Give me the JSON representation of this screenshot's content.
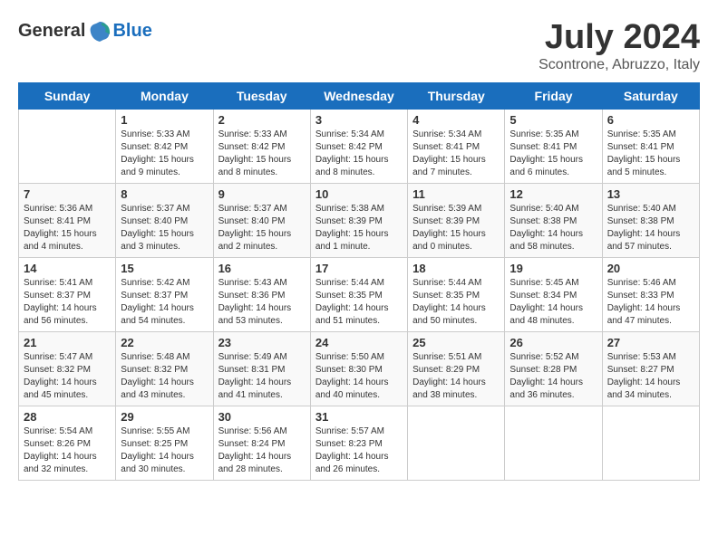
{
  "header": {
    "logo_general": "General",
    "logo_blue": "Blue",
    "month_title": "July 2024",
    "subtitle": "Scontrone, Abruzzo, Italy"
  },
  "days_of_week": [
    "Sunday",
    "Monday",
    "Tuesday",
    "Wednesday",
    "Thursday",
    "Friday",
    "Saturday"
  ],
  "weeks": [
    [
      {
        "day": "",
        "info": ""
      },
      {
        "day": "1",
        "info": "Sunrise: 5:33 AM\nSunset: 8:42 PM\nDaylight: 15 hours\nand 9 minutes."
      },
      {
        "day": "2",
        "info": "Sunrise: 5:33 AM\nSunset: 8:42 PM\nDaylight: 15 hours\nand 8 minutes."
      },
      {
        "day": "3",
        "info": "Sunrise: 5:34 AM\nSunset: 8:42 PM\nDaylight: 15 hours\nand 8 minutes."
      },
      {
        "day": "4",
        "info": "Sunrise: 5:34 AM\nSunset: 8:41 PM\nDaylight: 15 hours\nand 7 minutes."
      },
      {
        "day": "5",
        "info": "Sunrise: 5:35 AM\nSunset: 8:41 PM\nDaylight: 15 hours\nand 6 minutes."
      },
      {
        "day": "6",
        "info": "Sunrise: 5:35 AM\nSunset: 8:41 PM\nDaylight: 15 hours\nand 5 minutes."
      }
    ],
    [
      {
        "day": "7",
        "info": "Sunrise: 5:36 AM\nSunset: 8:41 PM\nDaylight: 15 hours\nand 4 minutes."
      },
      {
        "day": "8",
        "info": "Sunrise: 5:37 AM\nSunset: 8:40 PM\nDaylight: 15 hours\nand 3 minutes."
      },
      {
        "day": "9",
        "info": "Sunrise: 5:37 AM\nSunset: 8:40 PM\nDaylight: 15 hours\nand 2 minutes."
      },
      {
        "day": "10",
        "info": "Sunrise: 5:38 AM\nSunset: 8:39 PM\nDaylight: 15 hours\nand 1 minute."
      },
      {
        "day": "11",
        "info": "Sunrise: 5:39 AM\nSunset: 8:39 PM\nDaylight: 15 hours\nand 0 minutes."
      },
      {
        "day": "12",
        "info": "Sunrise: 5:40 AM\nSunset: 8:38 PM\nDaylight: 14 hours\nand 58 minutes."
      },
      {
        "day": "13",
        "info": "Sunrise: 5:40 AM\nSunset: 8:38 PM\nDaylight: 14 hours\nand 57 minutes."
      }
    ],
    [
      {
        "day": "14",
        "info": "Sunrise: 5:41 AM\nSunset: 8:37 PM\nDaylight: 14 hours\nand 56 minutes."
      },
      {
        "day": "15",
        "info": "Sunrise: 5:42 AM\nSunset: 8:37 PM\nDaylight: 14 hours\nand 54 minutes."
      },
      {
        "day": "16",
        "info": "Sunrise: 5:43 AM\nSunset: 8:36 PM\nDaylight: 14 hours\nand 53 minutes."
      },
      {
        "day": "17",
        "info": "Sunrise: 5:44 AM\nSunset: 8:35 PM\nDaylight: 14 hours\nand 51 minutes."
      },
      {
        "day": "18",
        "info": "Sunrise: 5:44 AM\nSunset: 8:35 PM\nDaylight: 14 hours\nand 50 minutes."
      },
      {
        "day": "19",
        "info": "Sunrise: 5:45 AM\nSunset: 8:34 PM\nDaylight: 14 hours\nand 48 minutes."
      },
      {
        "day": "20",
        "info": "Sunrise: 5:46 AM\nSunset: 8:33 PM\nDaylight: 14 hours\nand 47 minutes."
      }
    ],
    [
      {
        "day": "21",
        "info": "Sunrise: 5:47 AM\nSunset: 8:32 PM\nDaylight: 14 hours\nand 45 minutes."
      },
      {
        "day": "22",
        "info": "Sunrise: 5:48 AM\nSunset: 8:32 PM\nDaylight: 14 hours\nand 43 minutes."
      },
      {
        "day": "23",
        "info": "Sunrise: 5:49 AM\nSunset: 8:31 PM\nDaylight: 14 hours\nand 41 minutes."
      },
      {
        "day": "24",
        "info": "Sunrise: 5:50 AM\nSunset: 8:30 PM\nDaylight: 14 hours\nand 40 minutes."
      },
      {
        "day": "25",
        "info": "Sunrise: 5:51 AM\nSunset: 8:29 PM\nDaylight: 14 hours\nand 38 minutes."
      },
      {
        "day": "26",
        "info": "Sunrise: 5:52 AM\nSunset: 8:28 PM\nDaylight: 14 hours\nand 36 minutes."
      },
      {
        "day": "27",
        "info": "Sunrise: 5:53 AM\nSunset: 8:27 PM\nDaylight: 14 hours\nand 34 minutes."
      }
    ],
    [
      {
        "day": "28",
        "info": "Sunrise: 5:54 AM\nSunset: 8:26 PM\nDaylight: 14 hours\nand 32 minutes."
      },
      {
        "day": "29",
        "info": "Sunrise: 5:55 AM\nSunset: 8:25 PM\nDaylight: 14 hours\nand 30 minutes."
      },
      {
        "day": "30",
        "info": "Sunrise: 5:56 AM\nSunset: 8:24 PM\nDaylight: 14 hours\nand 28 minutes."
      },
      {
        "day": "31",
        "info": "Sunrise: 5:57 AM\nSunset: 8:23 PM\nDaylight: 14 hours\nand 26 minutes."
      },
      {
        "day": "",
        "info": ""
      },
      {
        "day": "",
        "info": ""
      },
      {
        "day": "",
        "info": ""
      }
    ]
  ]
}
